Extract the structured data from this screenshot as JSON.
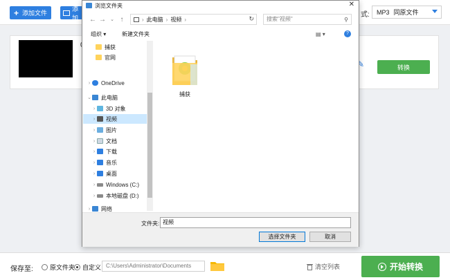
{
  "app": {
    "add_file_label": "添加文件",
    "add_folder_label": "添加",
    "format_label": "式:",
    "format_value": "MP3",
    "format_option": "同原文件",
    "card_name": "0",
    "convert_label": "转换",
    "save_to_label": "保存至:",
    "radio_original": "原文件夹",
    "radio_custom": "自定义",
    "output_path": "C:\\Users\\Administrator\\Documents",
    "clear_list_label": "清空列表",
    "start_label": "开始转换",
    "accent_color": "#2e7fe0",
    "green_color": "#4caf50"
  },
  "dialog": {
    "title": "浏览文件夹",
    "address": [
      "此电脑",
      "视频"
    ],
    "search_placeholder": "搜索\"视频\"",
    "organize_label": "组织 ▾",
    "new_folder_label": "新建文件夹",
    "tree": [
      {
        "label": "捕获",
        "icon": "folder"
      },
      {
        "label": "官网",
        "icon": "folder"
      },
      {
        "label": "OneDrive",
        "icon": "cloud"
      },
      {
        "label": "此电脑",
        "icon": "pc"
      },
      {
        "label": "3D 对象",
        "icon": "3d"
      },
      {
        "label": "视频",
        "icon": "video",
        "selected": true
      },
      {
        "label": "图片",
        "icon": "pictures"
      },
      {
        "label": "文档",
        "icon": "documents"
      },
      {
        "label": "下载",
        "icon": "downloads"
      },
      {
        "label": "音乐",
        "icon": "music"
      },
      {
        "label": "桌面",
        "icon": "desktop"
      },
      {
        "label": "Windows (C:)",
        "icon": "drive"
      },
      {
        "label": "本地磁盘 (D:)",
        "icon": "drive"
      },
      {
        "label": "网络",
        "icon": "network"
      }
    ],
    "content_items": [
      {
        "label": "捕获"
      }
    ],
    "folder_field_label": "文件夹:",
    "folder_field_value": "视频",
    "select_button": "选择文件夹",
    "cancel_button": "取消"
  }
}
